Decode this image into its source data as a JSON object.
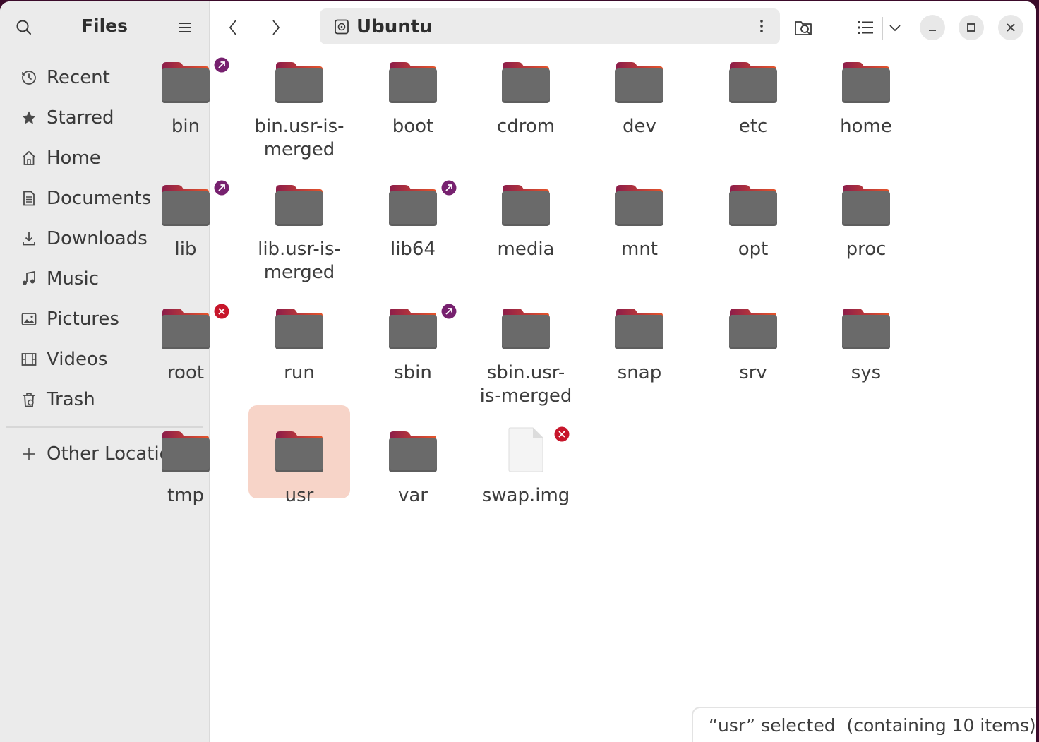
{
  "app": {
    "title": "Files"
  },
  "sidebar": {
    "items": [
      {
        "label": "Recent",
        "icon": "clock-icon"
      },
      {
        "label": "Starred",
        "icon": "star-icon"
      },
      {
        "label": "Home",
        "icon": "home-icon"
      },
      {
        "label": "Documents",
        "icon": "document-icon"
      },
      {
        "label": "Downloads",
        "icon": "download-icon"
      },
      {
        "label": "Music",
        "icon": "music-icon"
      },
      {
        "label": "Pictures",
        "icon": "picture-icon"
      },
      {
        "label": "Videos",
        "icon": "video-icon"
      },
      {
        "label": "Trash",
        "icon": "trash-icon"
      }
    ],
    "other": {
      "label": "Other Locations",
      "icon": "plus-icon"
    }
  },
  "path": {
    "label": "Ubuntu",
    "icon": "disk-icon"
  },
  "items": [
    {
      "name": "bin",
      "type": "folder",
      "emblem": "link"
    },
    {
      "name": "bin.usr-is-merged",
      "type": "folder",
      "emblem": ""
    },
    {
      "name": "boot",
      "type": "folder",
      "emblem": ""
    },
    {
      "name": "cdrom",
      "type": "folder",
      "emblem": ""
    },
    {
      "name": "dev",
      "type": "folder",
      "emblem": ""
    },
    {
      "name": "etc",
      "type": "folder",
      "emblem": ""
    },
    {
      "name": "home",
      "type": "folder",
      "emblem": ""
    },
    {
      "name": "lib",
      "type": "folder",
      "emblem": "link"
    },
    {
      "name": "lib.usr-is-merged",
      "type": "folder",
      "emblem": ""
    },
    {
      "name": "lib64",
      "type": "folder",
      "emblem": "link"
    },
    {
      "name": "media",
      "type": "folder",
      "emblem": ""
    },
    {
      "name": "mnt",
      "type": "folder",
      "emblem": ""
    },
    {
      "name": "opt",
      "type": "folder",
      "emblem": ""
    },
    {
      "name": "proc",
      "type": "folder",
      "emblem": ""
    },
    {
      "name": "root",
      "type": "folder",
      "emblem": "unreadable"
    },
    {
      "name": "run",
      "type": "folder",
      "emblem": ""
    },
    {
      "name": "sbin",
      "type": "folder",
      "emblem": "link"
    },
    {
      "name": "sbin.usr-is-merged",
      "type": "folder",
      "emblem": ""
    },
    {
      "name": "snap",
      "type": "folder",
      "emblem": ""
    },
    {
      "name": "srv",
      "type": "folder",
      "emblem": ""
    },
    {
      "name": "sys",
      "type": "folder",
      "emblem": ""
    },
    {
      "name": "tmp",
      "type": "folder",
      "emblem": ""
    },
    {
      "name": "usr",
      "type": "folder",
      "emblem": "",
      "selected": true
    },
    {
      "name": "var",
      "type": "folder",
      "emblem": ""
    },
    {
      "name": "swap.img",
      "type": "file",
      "emblem": "unreadable"
    }
  ],
  "status": {
    "text": "“usr” selected  (containing 10 items)"
  },
  "colors": {
    "accent": "#e95420",
    "selection": "#f7d4c8",
    "link_emblem": "#77216f",
    "error_emblem": "#c7162b",
    "folder_body": "#6a6a6a",
    "folder_tab": "#a9204e"
  }
}
